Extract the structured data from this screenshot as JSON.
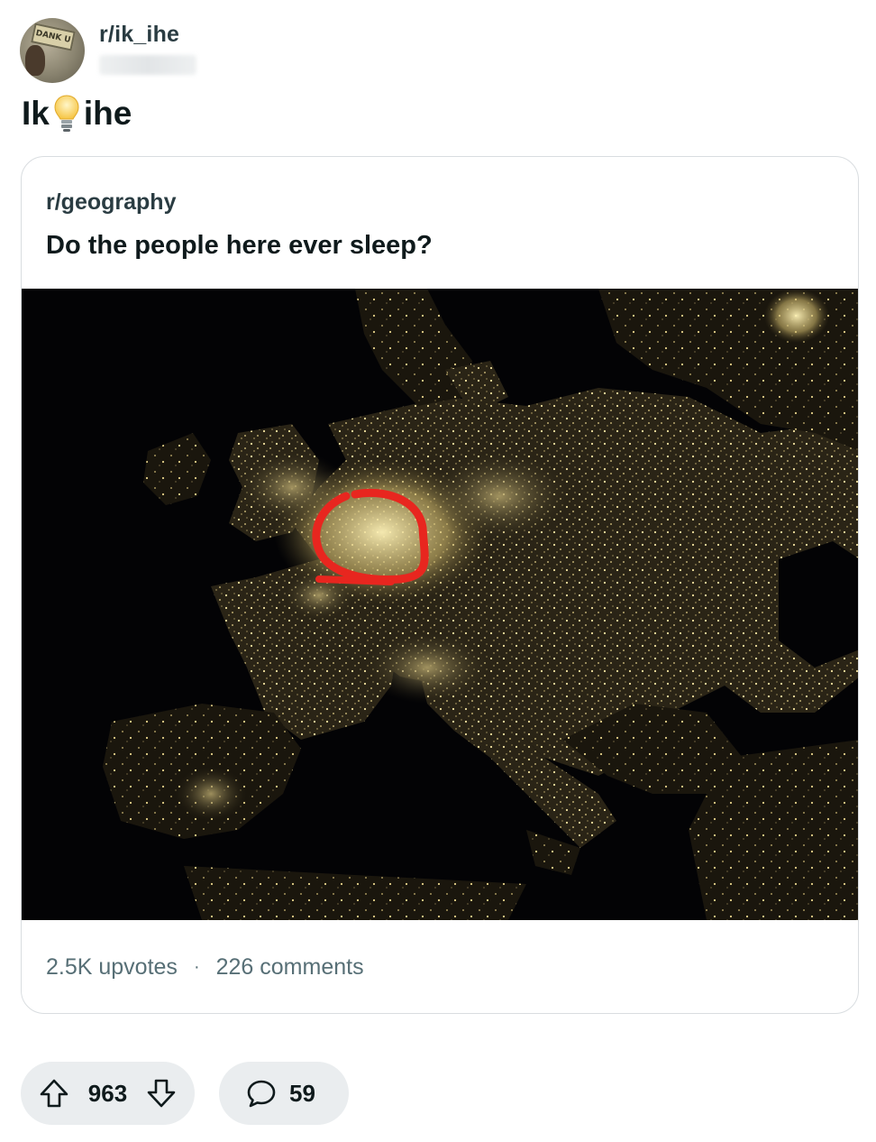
{
  "post": {
    "author_subreddit": "r/ik_ihe",
    "title_left": "Ik",
    "title_icon": "lightbulb-icon",
    "title_right": "ihe",
    "avatar_sign_text": "DANK U"
  },
  "crosspost": {
    "subreddit": "r/geography",
    "title": "Do the people here ever sleep?",
    "image": "europe-night-lights-map",
    "upvotes": "2.5K upvotes",
    "separator": "·",
    "comments": "226 comments"
  },
  "actions": {
    "vote_count": "963",
    "comment_count": "59",
    "upvote_icon": "upvote-arrow-icon",
    "downvote_icon": "downvote-arrow-icon",
    "comment_icon": "comment-bubble-icon"
  },
  "colors": {
    "highlight_circle": "#e8261f",
    "stats_text": "#576f76",
    "pill_bg": "#eaedef"
  }
}
